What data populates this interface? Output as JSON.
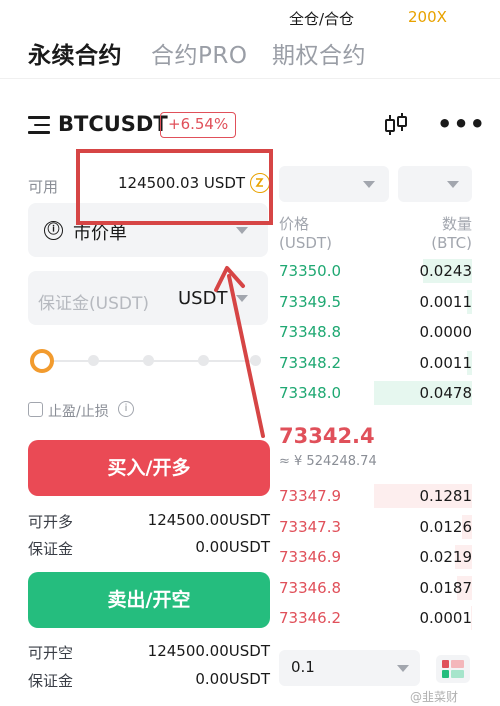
{
  "top_tabs": [
    "永续合约",
    "合约PRO",
    "期权合约"
  ],
  "header": {
    "pair": "BTCUSDT",
    "change": "+6.54%",
    "menu_icon": "menu-icon",
    "chart_icon": "candlestick-icon",
    "more_icon": "more-icon",
    "more_glyph": "•••"
  },
  "order_form": {
    "available_label": "可用",
    "available_value": "124500.03 USDT",
    "swap_icon": "swap-icon",
    "order_type_icon": "ⓘ",
    "order_type": "市价单",
    "margin_placeholder": "保证金(USDT)",
    "margin_unit": "USDT",
    "slider_value": 0,
    "tpsl_label": "止盈/止损",
    "help_glyph": "i",
    "buy_button": "买入/开多",
    "sell_button": "卖出/开空",
    "buy_info": [
      {
        "label": "可开多",
        "value": "124500.00USDT"
      },
      {
        "label": "保证金",
        "value": "0.00USDT"
      }
    ],
    "sell_info": [
      {
        "label": "可开空",
        "value": "124500.00USDT"
      },
      {
        "label": "保证金",
        "value": "0.00USDT"
      }
    ]
  },
  "orderbook": {
    "margin_mode": "全仓/合仓",
    "leverage": "200X",
    "price_header": "价格",
    "price_unit": "(USDT)",
    "qty_header": "数量",
    "qty_unit": "(BTC)",
    "asks": [
      {
        "price": "73350.0",
        "qty": "0.0243",
        "depth": 0.5
      },
      {
        "price": "73349.5",
        "qty": "0.0011",
        "depth": 0.05
      },
      {
        "price": "73348.8",
        "qty": "0.0000",
        "depth": 0.0
      },
      {
        "price": "73348.2",
        "qty": "0.0011",
        "depth": 0.05
      },
      {
        "price": "73348.0",
        "qty": "0.0478",
        "depth": 1.0
      }
    ],
    "last_price": "73342.4",
    "fiat_price": "≈ ¥ 524248.74",
    "bids": [
      {
        "price": "73347.9",
        "qty": "0.1281",
        "depth": 1.0
      },
      {
        "price": "73347.3",
        "qty": "0.0126",
        "depth": 0.1
      },
      {
        "price": "73346.9",
        "qty": "0.0219",
        "depth": 0.17
      },
      {
        "price": "73346.8",
        "qty": "0.0187",
        "depth": 0.15
      },
      {
        "price": "73346.2",
        "qty": "0.0001",
        "depth": 0.01
      }
    ],
    "precision": "0.1",
    "layout_icon": "orderbook-layout-icon"
  },
  "watermark": "@韭菜财",
  "colors": {
    "buy": "#ea4a55",
    "sell": "#25bd7e",
    "accent": "#f29b2e",
    "annotation": "#d64545"
  }
}
